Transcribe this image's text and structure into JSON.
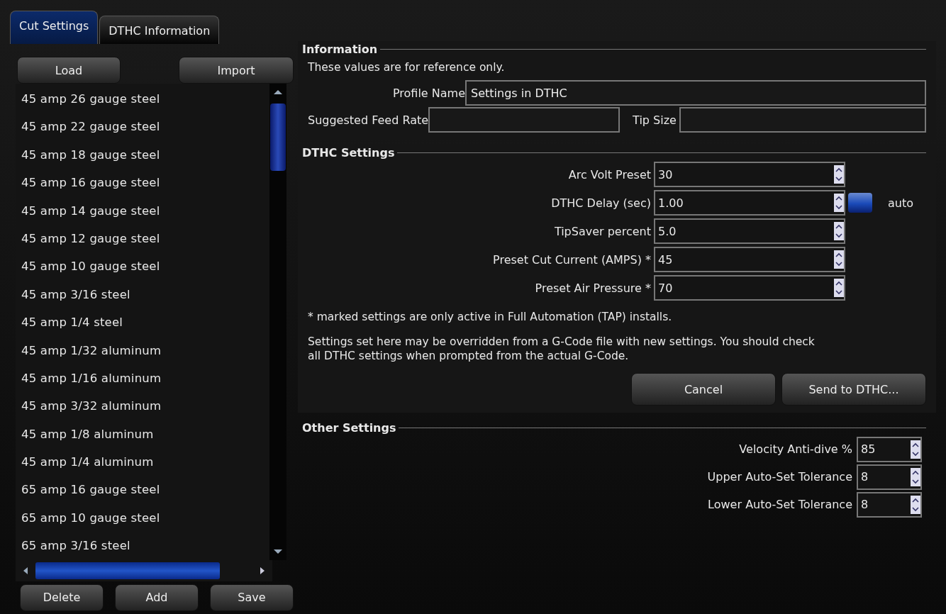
{
  "tabs": [
    {
      "label": "Cut Settings",
      "selected": true
    },
    {
      "label": "DTHC Information",
      "selected": false
    }
  ],
  "profiles": {
    "top_buttons": [
      "Load",
      "Import"
    ],
    "items": [
      "45 amp 26 gauge steel",
      "45 amp 22 gauge steel",
      "45 amp 18 gauge steel",
      "45 amp 16 gauge steel",
      "45 amp 14 gauge steel",
      "45 amp 12 gauge steel",
      "45 amp 10 gauge steel",
      "45 amp 3/16 steel",
      "45 amp 1/4 steel",
      "45 amp 1/32 aluminum",
      "45 amp 1/16 aluminum",
      "45 amp 3/32 aluminum",
      "45 amp 1/8 aluminum",
      "45 amp 1/4 aluminum",
      "65 amp 16 gauge steel",
      "65 amp 10 gauge steel",
      "65 amp 3/16 steel"
    ],
    "bottom_buttons": [
      "Delete",
      "Add",
      "Save"
    ]
  },
  "information": {
    "title": "Information",
    "note": "These values are for reference only.",
    "profile_name": {
      "label": "Profile Name",
      "value": "Settings in DTHC"
    },
    "feed_rate": {
      "label": "Suggested Feed Rate"
    },
    "tip_size": {
      "label": "Tip Size"
    }
  },
  "dthc_settings": {
    "title": "DTHC Settings",
    "fields": [
      {
        "label": "Arc Volt Preset",
        "value": "30"
      },
      {
        "label": "DTHC Delay (sec)",
        "value": "1.00",
        "toggle": {
          "label": "auto",
          "on": true
        }
      },
      {
        "label": "TipSaver percent",
        "value": "5.0"
      },
      {
        "label": "Preset Cut Current (AMPS) *",
        "value": "45"
      },
      {
        "label": "Preset Air Pressure *",
        "value": "70"
      }
    ],
    "footnote": "* marked settings are only active in Full Automation (TAP) installs.",
    "warning": "Settings set here may be overridden from a G-Code file with new settings.  You should check all DTHC settings when prompted from the actual G-Code.",
    "buttons": [
      "Cancel",
      "Send to DTHC..."
    ]
  },
  "other_settings": {
    "title": "Other Settings",
    "fields": [
      {
        "label": "Velocity Anti-dive %",
        "value": "85"
      },
      {
        "label": "Upper Auto-Set Tolerance",
        "value": "8"
      },
      {
        "label": "Lower Auto-Set Tolerance",
        "value": "8"
      }
    ]
  }
}
